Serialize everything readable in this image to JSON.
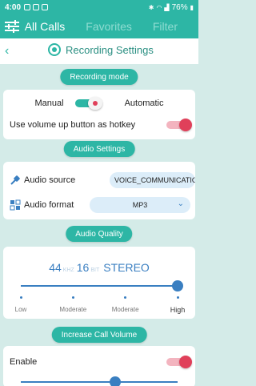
{
  "status_bar": {
    "time": "4:00",
    "battery": "76%"
  },
  "tabs": [
    {
      "label": "All Calls",
      "active": true
    },
    {
      "label": "Favorites",
      "active": false
    },
    {
      "label": "Filter",
      "active": false
    }
  ],
  "header": {
    "title": "Recording Settings"
  },
  "recording_mode": {
    "section_label": "Recording mode",
    "manual_label": "Manual",
    "automatic_label": "Automatic",
    "hotkey_label": "Use volume up button as hotkey",
    "hotkey_enabled": true
  },
  "audio_settings": {
    "section_label": "Audio Settings",
    "source_label": "Audio source",
    "source_value": "VOICE_COMMUNICATIO",
    "format_label": "Audio format",
    "format_value": "MP3"
  },
  "audio_quality": {
    "section_label": "Audio Quality",
    "sample_rate": "44",
    "sample_rate_unit": "KHZ",
    "bit_depth": "16",
    "bit_depth_unit": "BIT",
    "channels": "STEREO",
    "level_labels": [
      "Low",
      "Moderate",
      "Moderate",
      "High"
    ],
    "selected_level_index": 3
  },
  "increase_volume": {
    "section_label": "Increase Call Volume",
    "enable_label": "Enable",
    "enabled": true
  },
  "colors": {
    "accent": "#2db6a5",
    "switch_on": "#e0405a",
    "slider": "#3a7fc1"
  }
}
